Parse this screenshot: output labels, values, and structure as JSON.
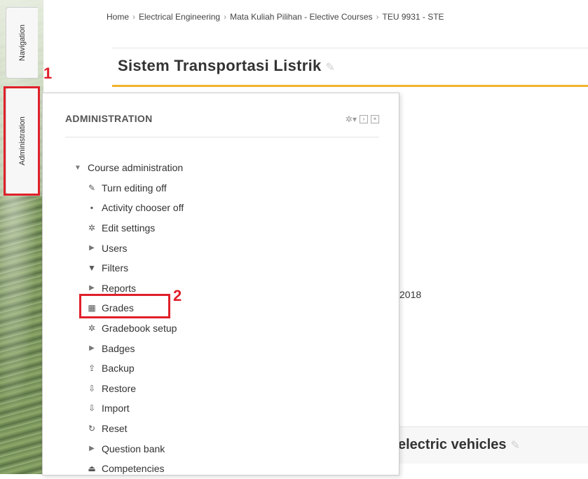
{
  "sidebar_tabs": {
    "navigation": "Navigation",
    "administration": "Administration"
  },
  "annotations": {
    "one": "1",
    "two": "2"
  },
  "breadcrumb": [
    "Home",
    "Electrical Engineering",
    "Mata Kuliah Pilihan - Elective Courses",
    "TEU 9931 - STE"
  ],
  "page_title": "Sistem Transportasi Listrik",
  "background_text": {
    "year": "2018",
    "section_title": "electric vehicles"
  },
  "admin_panel": {
    "title": "ADMINISTRATION",
    "root_label": "Course administration",
    "items": [
      {
        "label": "Turn editing off",
        "icon": "pencil-icon"
      },
      {
        "label": "Activity chooser off",
        "icon": "bullet-icon"
      },
      {
        "label": "Edit settings",
        "icon": "gear-icon"
      },
      {
        "label": "Users",
        "icon": "expand-arrow-icon"
      },
      {
        "label": "Filters",
        "icon": "filter-icon"
      },
      {
        "label": "Reports",
        "icon": "expand-arrow-icon"
      },
      {
        "label": "Grades",
        "icon": "table-icon"
      },
      {
        "label": "Gradebook setup",
        "icon": "gear-icon"
      },
      {
        "label": "Badges",
        "icon": "expand-arrow-icon"
      },
      {
        "label": "Backup",
        "icon": "upload-icon"
      },
      {
        "label": "Restore",
        "icon": "download-icon"
      },
      {
        "label": "Import",
        "icon": "download-icon"
      },
      {
        "label": "Reset",
        "icon": "reset-icon"
      },
      {
        "label": "Question bank",
        "icon": "expand-arrow-icon"
      },
      {
        "label": "Competencies",
        "icon": "eject-icon"
      }
    ]
  },
  "colors": {
    "highlight": "#e0202a",
    "title_underline": "#f0b429"
  }
}
